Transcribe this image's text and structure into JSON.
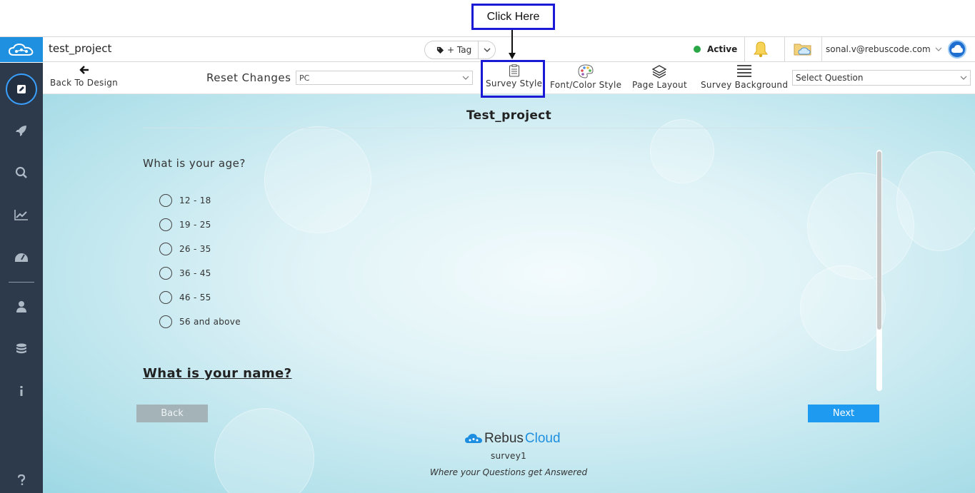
{
  "annotation": {
    "callout_text": "Click Here"
  },
  "header": {
    "project_name": "test_project",
    "tag_label": "+ Tag",
    "status_label": "Active",
    "user_email": "sonal.v@rebuscode.com"
  },
  "toolbar": {
    "back_label": "Back To Design",
    "reset_label": "Reset Changes",
    "device_value": "PC",
    "tools": {
      "survey_style": "Survey Style",
      "font_color_style": "Font/Color Style",
      "page_layout": "Page Layout",
      "survey_background": "Survey Background"
    },
    "question_select_value": "Select Question"
  },
  "survey": {
    "title": "Test_project",
    "question1": "What is your age?",
    "options": [
      "12 - 18",
      "19 - 25",
      "26 - 35",
      "36 - 45",
      "46 - 55",
      "56 and above"
    ],
    "question2": "What is your name?",
    "back_label": "Back",
    "next_label": "Next"
  },
  "footer": {
    "brand_part1": "Rebus",
    "brand_part2": "Cloud",
    "survey_name": "survey1",
    "tagline": "Where your Questions get Answered"
  },
  "colors": {
    "accent": "#1e9af0",
    "sidebar": "#2c3a4b",
    "highlight": "#1a1ad6",
    "status_active": "#2aa848"
  }
}
